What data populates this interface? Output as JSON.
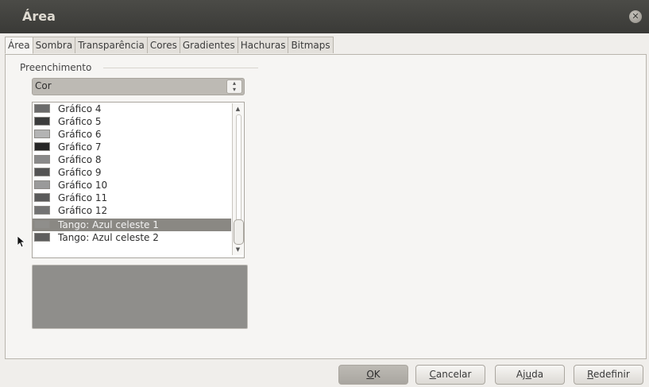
{
  "window": {
    "title": "Área",
    "close_glyph": "✕"
  },
  "tabs": [
    {
      "label": "Área",
      "active": true
    },
    {
      "label": "Sombra"
    },
    {
      "label": "Transparência"
    },
    {
      "label": "Cores"
    },
    {
      "label": "Gradientes"
    },
    {
      "label": "Hachuras"
    },
    {
      "label": "Bitmaps"
    }
  ],
  "fill": {
    "group_label": "Preenchimento",
    "type_value": "Cor",
    "colors": [
      {
        "label": "Gráfico 4",
        "color": "#6b6b6b"
      },
      {
        "label": "Gráfico 5",
        "color": "#3b3b3b"
      },
      {
        "label": "Gráfico 6",
        "color": "#b4b4b4"
      },
      {
        "label": "Gráfico 7",
        "color": "#262626"
      },
      {
        "label": "Gráfico 8",
        "color": "#8a8a8a"
      },
      {
        "label": "Gráfico 9",
        "color": "#545454"
      },
      {
        "label": "Gráfico 10",
        "color": "#9a9a9a"
      },
      {
        "label": "Gráfico 11",
        "color": "#5a5a5a"
      },
      {
        "label": "Gráfico 12",
        "color": "#737373"
      },
      {
        "label": "Tango: Azul celeste 1",
        "color": "#8f8e8b",
        "selected": true
      },
      {
        "label": "Tango: Azul celeste 2",
        "color": "#5e5e5e"
      }
    ],
    "preview_color": "#8f8e8b"
  },
  "buttons": {
    "ok": {
      "mnemonic": "O",
      "rest": "K"
    },
    "cancel": {
      "mnemonic": "C",
      "rest": "ancelar"
    },
    "help": {
      "before": "Aj",
      "mnemonic": "u",
      "rest": "da"
    },
    "reset": {
      "mnemonic": "R",
      "rest": "edefinir"
    }
  }
}
